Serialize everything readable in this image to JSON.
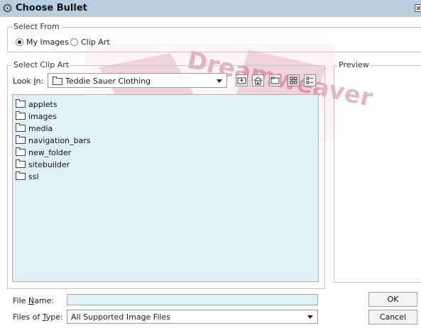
{
  "window": {
    "title": "Choose Bullet"
  },
  "select_from": {
    "legend": "Select From",
    "options": [
      {
        "label": "My Images",
        "selected": true
      },
      {
        "label": "Clip Art",
        "selected": false
      }
    ]
  },
  "select_clip_art": {
    "legend": "Select Clip Art",
    "look_in": {
      "label_prefix": "Look ",
      "label_mnemonic": "I",
      "label_suffix": "n:",
      "value": "Teddie Sauer Clothing"
    },
    "toolbar_icons": [
      "up-folder-icon",
      "home-icon",
      "new-folder-icon",
      "list-view-icon",
      "details-view-icon"
    ],
    "files": [
      {
        "name": "applets"
      },
      {
        "name": "images"
      },
      {
        "name": "media"
      },
      {
        "name": "navigation_bars"
      },
      {
        "name": "new_folder"
      },
      {
        "name": "sitebuilder"
      },
      {
        "name": "ssl"
      }
    ]
  },
  "preview": {
    "legend": "Preview"
  },
  "file_name": {
    "label_prefix": "File ",
    "label_mnemonic": "N",
    "label_suffix": "ame:",
    "value": ""
  },
  "files_of_type": {
    "label_prefix": "Files of ",
    "label_mnemonic": "T",
    "label_suffix": "ype:",
    "value": "All Supported Image Files"
  },
  "buttons": {
    "ok": "OK",
    "cancel": "Cancel"
  },
  "watermark": {
    "text": "Dreamweaver"
  },
  "colors": {
    "titlebar": "#b9cfe0",
    "file_list_bg": "#dff1f5",
    "watermark": "#b5365f"
  }
}
